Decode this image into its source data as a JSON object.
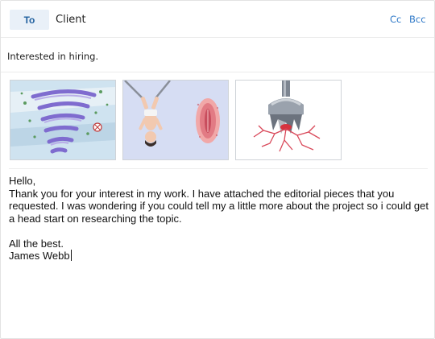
{
  "header": {
    "to_label": "To",
    "recipient": "Client",
    "cc_label": "Cc",
    "bcc_label": "Bcc"
  },
  "subject": "Interested in hiring.",
  "attachments": [
    {
      "icon": "tornado-illustration"
    },
    {
      "icon": "hanging-figure-illustration"
    },
    {
      "icon": "drill-cracks-illustration"
    }
  ],
  "body": {
    "greeting": "Hello,",
    "paragraph": "Thank you for your interest in my work. I have attached the editorial pieces that you requested. I was wondering if you could tell my a little more about the project so i could get a head start on researching the topic.",
    "signoff": "All the best.",
    "signature": "James Webb"
  },
  "colors": {
    "accent": "#2f79c8",
    "to_pill_bg": "#e9f0f8",
    "to_pill_text": "#1f5f9e",
    "border": "#e3e3e3"
  }
}
